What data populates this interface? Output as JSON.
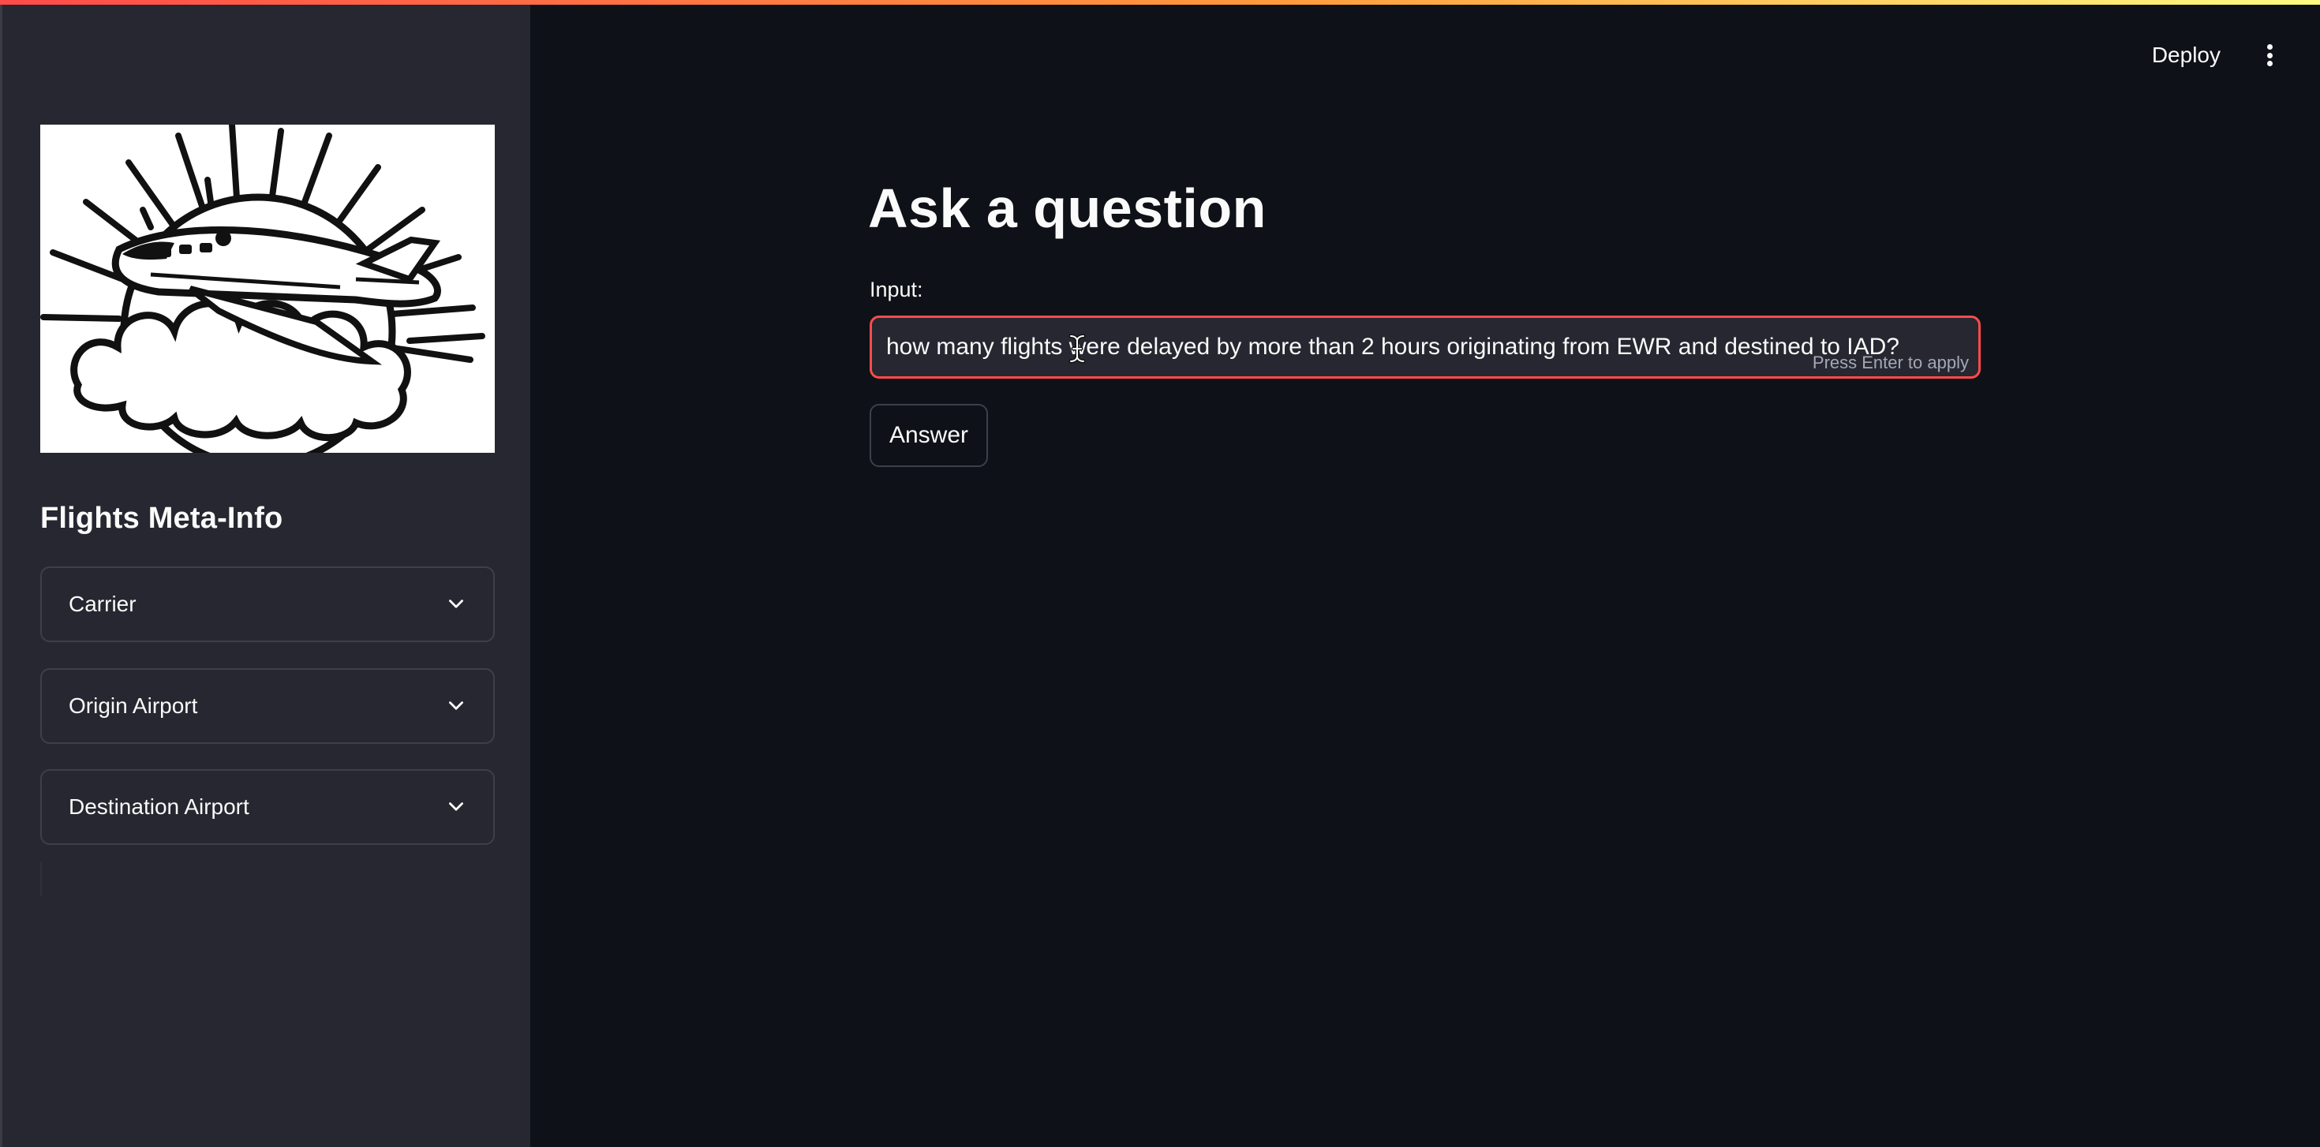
{
  "header": {
    "deploy_label": "Deploy",
    "menu_icon": "vertical-dots-icon"
  },
  "sidebar": {
    "logo_icon": "airplane-logo",
    "title": "Flights Meta-Info",
    "expanders": [
      {
        "label": "Carrier",
        "icon": "chevron-down-icon"
      },
      {
        "label": "Origin Airport",
        "icon": "chevron-down-icon"
      },
      {
        "label": "Destination Airport",
        "icon": "chevron-down-icon"
      }
    ]
  },
  "main": {
    "title": "Ask a question",
    "input": {
      "label": "Input:",
      "value": "how many flights were delayed by more than 2 hours originating from EWR and destined to IAD?",
      "hint": "Press Enter to apply"
    },
    "button_label": "Answer"
  },
  "colors": {
    "background": "#0e1117",
    "sidebar": "#262730",
    "accent": "#ff4b4b",
    "text": "#fafafa"
  }
}
